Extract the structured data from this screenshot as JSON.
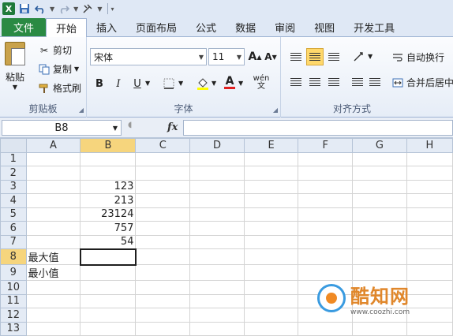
{
  "tabs": [
    "文件",
    "开始",
    "插入",
    "页面布局",
    "公式",
    "数据",
    "审阅",
    "视图",
    "开发工具"
  ],
  "clipboard": {
    "paste_label": "粘贴",
    "cut_label": "剪切",
    "copy_label": "复制",
    "painter_label": "格式刷",
    "group_label": "剪贴板"
  },
  "font": {
    "name": "宋体",
    "size": "11",
    "bold": "B",
    "italic": "I",
    "underline": "U",
    "grow": "A",
    "shrink": "A",
    "color_letter": "A",
    "phonetic": "wén",
    "group_label": "字体"
  },
  "alignment": {
    "wrap_label": "自动换行",
    "merge_label": "合并后居中",
    "group_label": "对齐方式"
  },
  "formula_bar": {
    "name_box": "B8",
    "fx": "fx",
    "value": ""
  },
  "grid": {
    "columns": [
      "A",
      "B",
      "C",
      "D",
      "E",
      "F",
      "G",
      "H"
    ],
    "selected_column": "B",
    "rows": [
      {
        "n": "1",
        "a": "",
        "b": ""
      },
      {
        "n": "2",
        "a": "",
        "b": ""
      },
      {
        "n": "3",
        "a": "",
        "b": "123"
      },
      {
        "n": "4",
        "a": "",
        "b": "213"
      },
      {
        "n": "5",
        "a": "",
        "b": "23124"
      },
      {
        "n": "6",
        "a": "",
        "b": "757"
      },
      {
        "n": "7",
        "a": "",
        "b": "54"
      },
      {
        "n": "8",
        "a": "最大值",
        "b": ""
      },
      {
        "n": "9",
        "a": "最小值",
        "b": ""
      },
      {
        "n": "10",
        "a": "",
        "b": ""
      },
      {
        "n": "11",
        "a": "",
        "b": ""
      },
      {
        "n": "12",
        "a": "",
        "b": ""
      },
      {
        "n": "13",
        "a": "",
        "b": ""
      }
    ],
    "active_row": "8"
  },
  "watermark": {
    "title": "酷知网",
    "url": "www.coozhi.com"
  },
  "colors": {
    "file_tab": "#2a8a43",
    "selection_header": "#f6d57d",
    "ribbon_bg": "#dfe8f5",
    "watermark_orange": "#e0872b"
  }
}
